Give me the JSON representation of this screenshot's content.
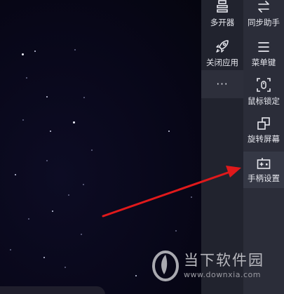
{
  "toolbar_left": {
    "multi_instance": "多开器",
    "close_app": "关闭应用",
    "more": "···"
  },
  "toolbar_right": {
    "sync_assistant": "同步助手",
    "menu_key": "菜单键",
    "mouse_lock": "鼠标锁定",
    "rotate_screen": "旋转屏幕",
    "gamepad_settings": "手柄设置"
  },
  "watermark": {
    "title": "当下软件园",
    "url": "www.downxia.com"
  },
  "colors": {
    "arrow": "#e0191b",
    "panel_left": "#21232e",
    "panel_right": "#2b2d39",
    "highlight": "#353845",
    "screen": "#0b0a1e"
  }
}
